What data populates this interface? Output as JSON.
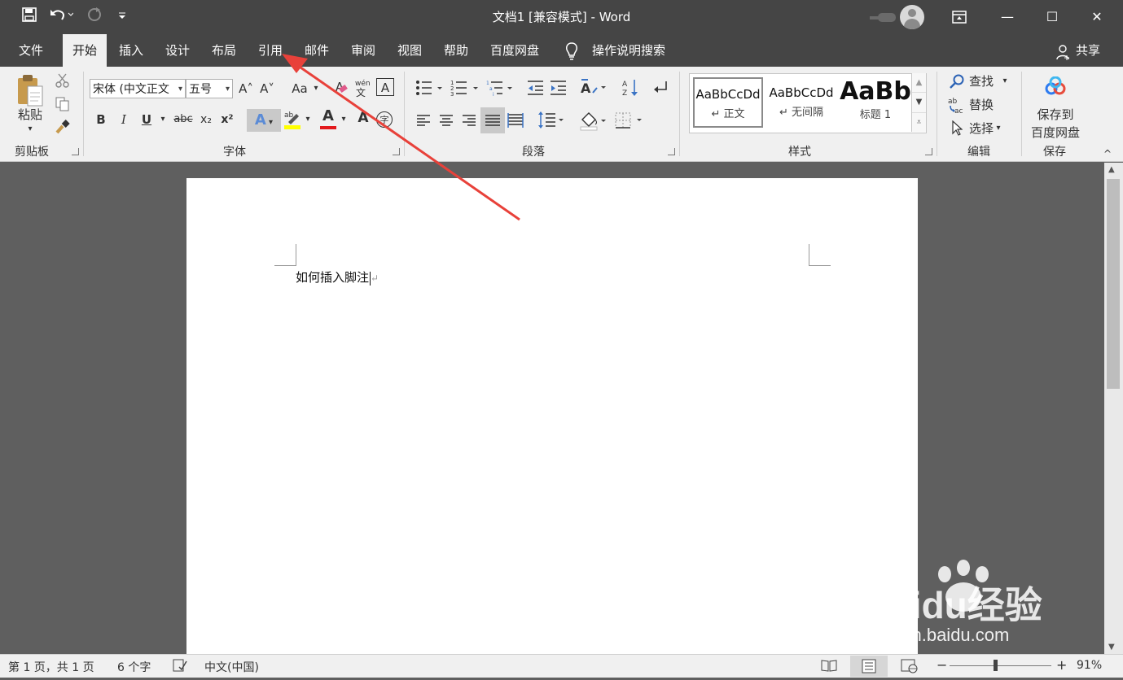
{
  "window": {
    "title": "文档1 [兼容模式] - Word",
    "minimize_label": "—",
    "maximize_label": "☐",
    "close_label": "✕"
  },
  "tabs": [
    {
      "label": "文件"
    },
    {
      "label": "开始"
    },
    {
      "label": "插入"
    },
    {
      "label": "设计"
    },
    {
      "label": "布局"
    },
    {
      "label": "引用"
    },
    {
      "label": "邮件"
    },
    {
      "label": "审阅"
    },
    {
      "label": "视图"
    },
    {
      "label": "帮助"
    },
    {
      "label": "百度网盘"
    },
    {
      "label": "操作说明搜索"
    }
  ],
  "share_label": "共享",
  "clipboard": {
    "paste_label": "粘贴",
    "group_label": "剪贴板"
  },
  "font": {
    "name": "宋体 (中文正文",
    "size": "五号",
    "group_label": "字体",
    "bold": "B",
    "italic": "I",
    "underline": "U",
    "strike": "abc",
    "subscript": "x₂",
    "superscript": "x²",
    "grow": "A˄",
    "shrink": "A˅",
    "case": "Aa",
    "clear_format": "A",
    "char_border": "A",
    "text_effect": "A",
    "font_color": "A",
    "char_shading": "A",
    "enclosed": "字"
  },
  "paragraph": {
    "group_label": "段落"
  },
  "styles": {
    "group_label": "样式",
    "items": [
      {
        "preview": "AaBbCcDd",
        "name": "↵ 正文"
      },
      {
        "preview": "AaBbCcDd",
        "name": "↵ 无间隔"
      },
      {
        "preview": "AaBb",
        "name": "标题 1"
      }
    ]
  },
  "editing": {
    "group_label": "编辑",
    "find": "查找",
    "replace": "替换",
    "select": "选择"
  },
  "save_group": {
    "group_label": "保存",
    "save_line1": "保存到",
    "save_line2": "百度网盘"
  },
  "document": {
    "text": "如何插入脚注"
  },
  "statusbar": {
    "page": "第 1 页，共 1 页",
    "words": "6 个字",
    "language": "中文(中国)",
    "zoom": "91%"
  },
  "watermark": {
    "brand": "Baidu经验",
    "url": "jingyan.baidu.com"
  },
  "colors": {
    "annotation_arrow": "#e8413a",
    "title_bg": "#454545",
    "ribbon_bg": "#f0f0f0"
  }
}
